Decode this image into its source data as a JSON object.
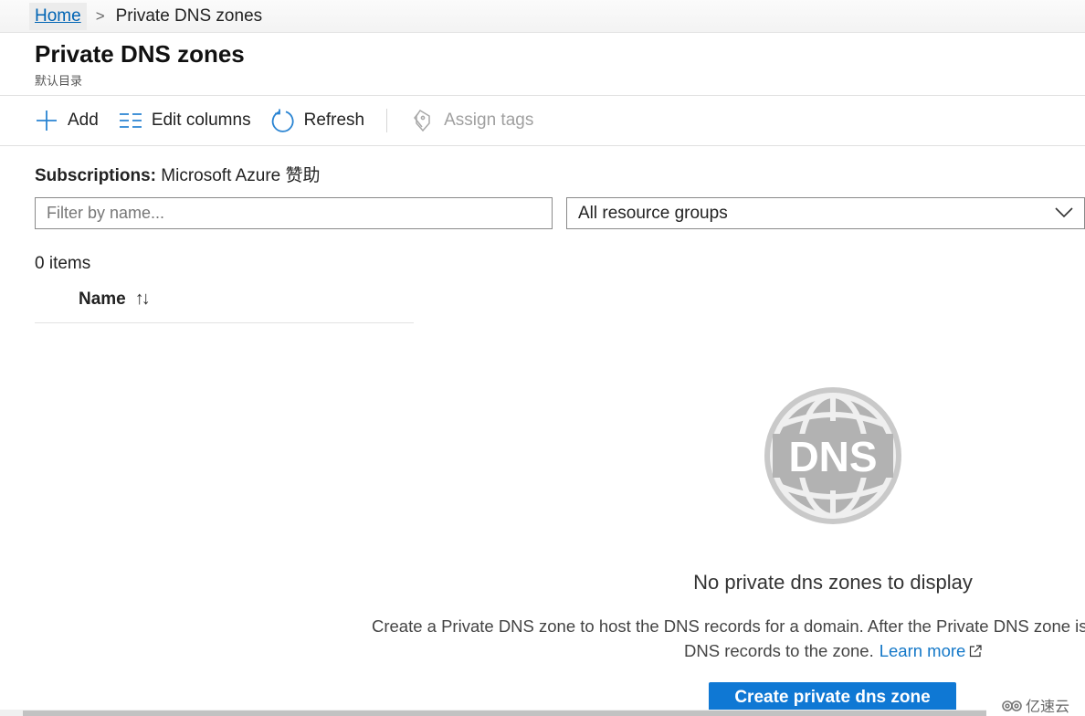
{
  "breadcrumb": {
    "home": "Home",
    "separator": ">",
    "current": "Private DNS zones"
  },
  "header": {
    "title": "Private DNS zones",
    "subtitle": "默认目录"
  },
  "toolbar": {
    "add_label": "Add",
    "edit_columns_label": "Edit columns",
    "refresh_label": "Refresh",
    "assign_tags_label": "Assign tags",
    "icons": [
      "plus-icon",
      "columns-icon",
      "refresh-icon",
      "tag-icon"
    ]
  },
  "filters": {
    "subscriptions_label": "Subscriptions:",
    "subscriptions_value": "Microsoft Azure 赞助",
    "name_filter_value": "",
    "name_filter_placeholder": "Filter by name...",
    "resource_group_selected": "All resource groups"
  },
  "list": {
    "item_count": "0 items",
    "columns": [
      {
        "label": "Name",
        "sort_icon": "↑↓"
      }
    ],
    "rows": []
  },
  "empty_state": {
    "icon": "dns-globe-icon",
    "icon_text": "DNS",
    "title": "No private dns zones to display",
    "description_line1": "Create a Private DNS zone to host the DNS records for a domain. After the Private DNS zone is c",
    "description_line2": "DNS records to the zone.",
    "learn_more": "Learn more",
    "create_button": "Create private dns zone"
  },
  "colors": {
    "accent": "#0f78d4",
    "link": "#1478c8",
    "icon_blue": "#2a84d2",
    "disabled": "#a0a0a0"
  },
  "watermark": "亿速云"
}
